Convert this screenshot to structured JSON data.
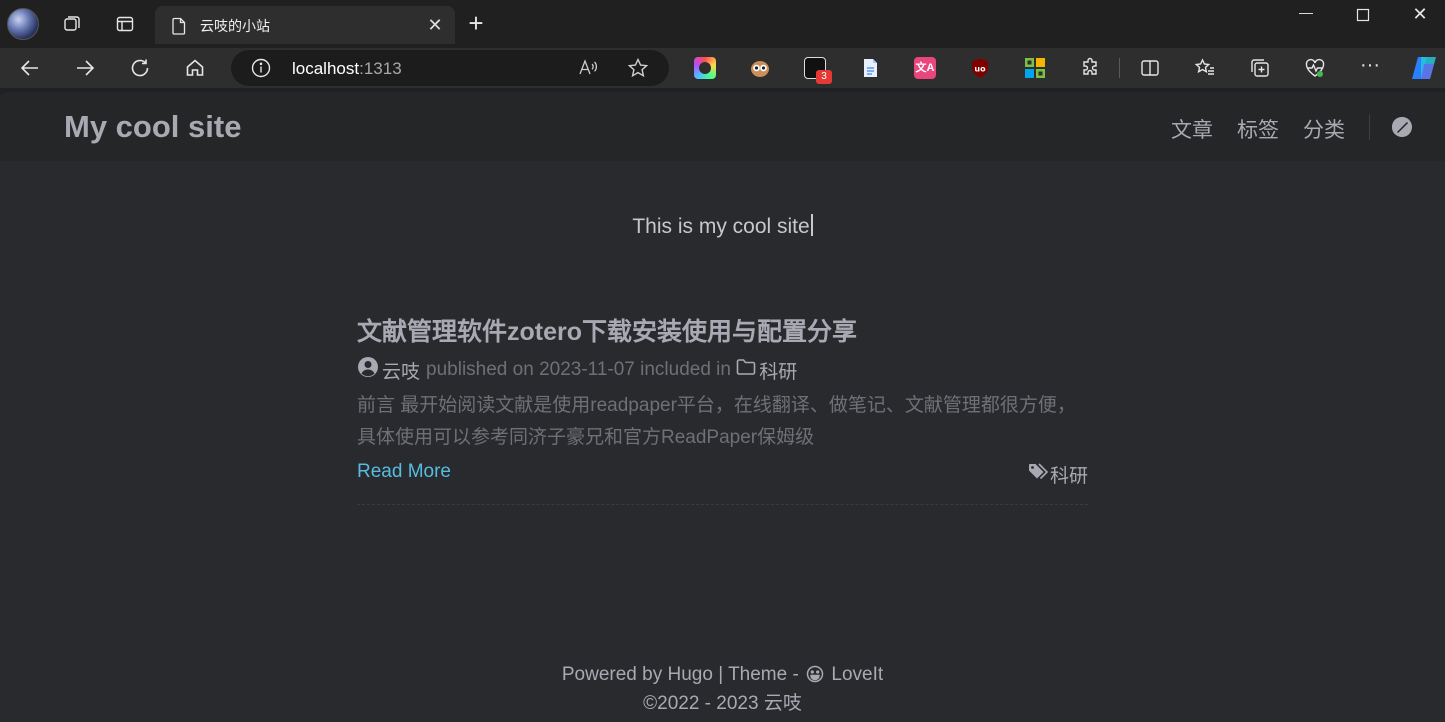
{
  "browser": {
    "tab_title": "云吱的小站",
    "url_host": "localhost",
    "url_port": ":1313",
    "extension_badge": "3",
    "colors": {
      "frame": "#202020",
      "toolbar": "#2e2e2e",
      "omnibox": "#1c1c1c"
    },
    "icons": [
      "profile-avatar",
      "workspaces-icon",
      "tab-actions-icon",
      "page-icon",
      "close-icon",
      "new-tab-icon",
      "minimize-icon",
      "maximize-icon",
      "close-window-icon",
      "back-icon",
      "forward-icon",
      "refresh-icon",
      "home-icon",
      "info-icon",
      "read-aloud-icon",
      "favorite-star-icon",
      "extensions-icon",
      "split-screen-icon",
      "favorites-icon",
      "collections-icon",
      "performance-icon",
      "more-icon",
      "copilot-icon"
    ]
  },
  "site": {
    "title": "My cool site",
    "menu": [
      "文章",
      "标签",
      "分类"
    ],
    "subtitle": "This is my cool site",
    "colors": {
      "header_bg": "#252627",
      "page_bg": "#292a2d",
      "text": "#a9a9b3",
      "muted": "#6f6f78",
      "link": "#55bde2"
    }
  },
  "post": {
    "title": "文献管理软件zotero下载安装使用与配置分享",
    "author": "云吱",
    "published_label": "published on",
    "date": "2023-11-07",
    "included_label": "included in",
    "category": "科研",
    "summary": "前言 最开始阅读文献是使用readpaper平台，在线翻译、做笔记、文献管理都很方便，具体使用可以参考同济子豪兄和官方ReadPaper保姆级",
    "read_more": "Read More",
    "tag": "科研"
  },
  "footer": {
    "powered_by": "Powered by",
    "hugo": "Hugo",
    "sep": "|",
    "theme_label": "Theme -",
    "theme_name": "LoveIt",
    "copyright": "©2022 - 2023",
    "owner": "云吱"
  }
}
